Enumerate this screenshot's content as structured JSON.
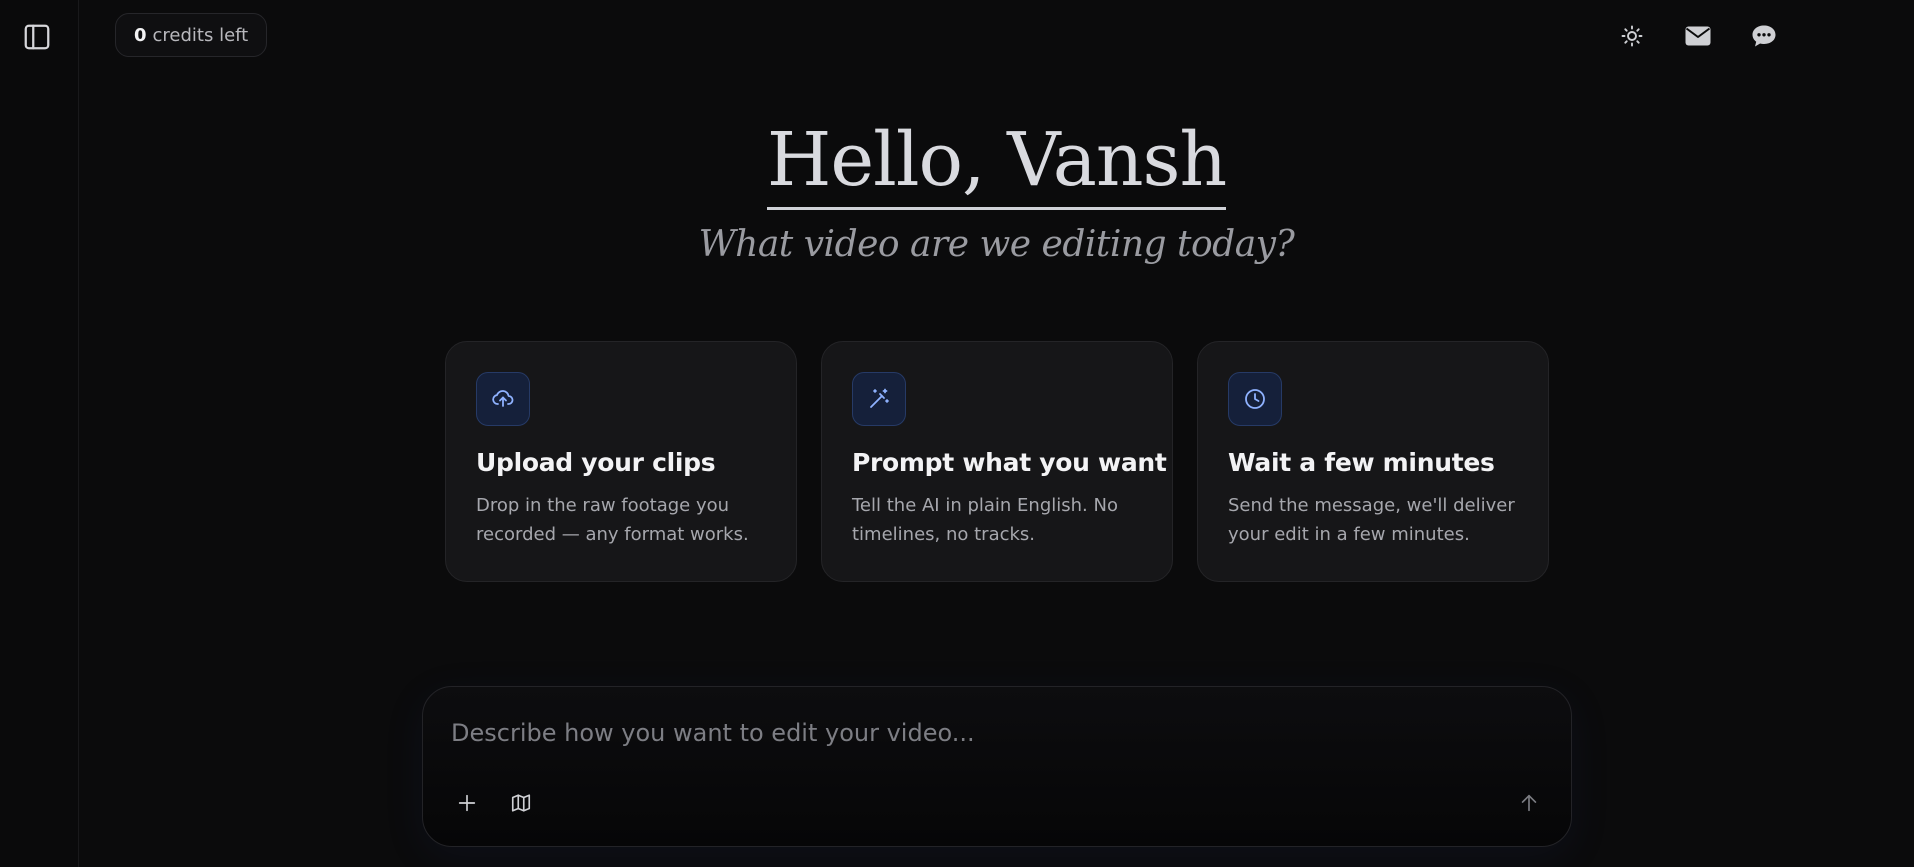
{
  "sidebar": {
    "toggle_icon": "sidebar-panel-icon"
  },
  "credits": {
    "count": "0",
    "label": "credits left"
  },
  "header": {
    "icons": [
      "sun-icon",
      "mail-icon",
      "chat-bubble-icon"
    ]
  },
  "hero": {
    "greeting": "Hello, Vansh",
    "subtitle": "What video are we editing today?"
  },
  "cards": [
    {
      "icon": "cloud-upload-icon",
      "title": "Upload your clips",
      "description": "Drop in the raw footage you recorded — any format works."
    },
    {
      "icon": "magic-wand-icon",
      "title": "Prompt what you want",
      "description": "Tell the AI in plain English. No timelines, no tracks."
    },
    {
      "icon": "clock-icon",
      "title": "Wait a few minutes",
      "description": "Send the message, we'll deliver your edit in a few minutes."
    }
  ],
  "composer": {
    "value": "",
    "placeholder": "Describe how you want to edit your video...",
    "actions": [
      "plus-icon",
      "map-icon",
      "arrow-up-icon"
    ]
  },
  "colors": {
    "background": "#0b0b0c",
    "card": "#161618",
    "icon_tile": "#15203a",
    "accent_icon": "#8fb2ff"
  }
}
